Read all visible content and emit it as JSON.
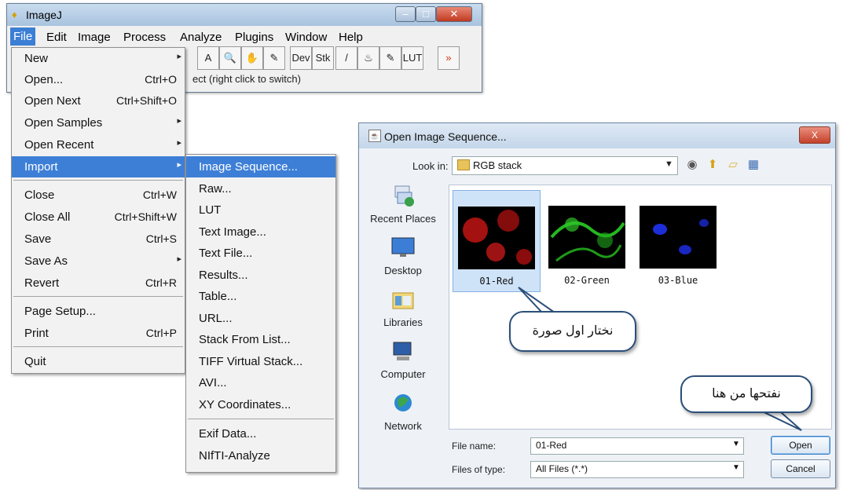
{
  "imagej": {
    "title": "ImageJ",
    "menubar": [
      "File",
      "Edit",
      "Image",
      "Process",
      "Analyze",
      "Plugins",
      "Window",
      "Help"
    ],
    "toolbar": [
      "A",
      "🔍",
      "✋",
      "✎",
      "Dev",
      "Stk",
      "/",
      "♨",
      "✎",
      "LUT",
      "»"
    ],
    "status": "ect (right click to switch)"
  },
  "file_menu": {
    "items": [
      {
        "label": "New",
        "shortcut": "",
        "arrow": "▸"
      },
      {
        "label": "Open...",
        "shortcut": "Ctrl+O"
      },
      {
        "label": "Open Next",
        "shortcut": "Ctrl+Shift+O"
      },
      {
        "label": "Open Samples",
        "shortcut": "",
        "arrow": "▸"
      },
      {
        "label": "Open Recent",
        "shortcut": "",
        "arrow": "▸"
      },
      {
        "label": "Import",
        "shortcut": "",
        "arrow": "▸"
      },
      {
        "label": "Close",
        "shortcut": "Ctrl+W"
      },
      {
        "label": "Close All",
        "shortcut": "Ctrl+Shift+W"
      },
      {
        "label": "Save",
        "shortcut": "Ctrl+S"
      },
      {
        "label": "Save As",
        "shortcut": "",
        "arrow": "▸"
      },
      {
        "label": "Revert",
        "shortcut": "Ctrl+R"
      },
      {
        "label": "Page Setup...",
        "shortcut": ""
      },
      {
        "label": "Print",
        "shortcut": "Ctrl+P"
      },
      {
        "label": "Quit",
        "shortcut": ""
      }
    ]
  },
  "import_menu": {
    "items": [
      "Image Sequence...",
      "Raw...",
      "LUT",
      "Text Image...",
      "Text File...",
      "Results...",
      "Table...",
      "URL...",
      "Stack From List...",
      "TIFF Virtual Stack...",
      "AVI...",
      "XY Coordinates...",
      "Exif Data...",
      "NIfTI-Analyze"
    ]
  },
  "dialog": {
    "title": "Open Image Sequence...",
    "close_label": "X",
    "lookin_label": "Look in:",
    "lookin_value": "RGB stack",
    "places": [
      "Recent Places",
      "Desktop",
      "Libraries",
      "Computer",
      "Network"
    ],
    "files": [
      {
        "label": "01-Red",
        "color": "#d01818"
      },
      {
        "label": "02-Green",
        "color": "#22b41e"
      },
      {
        "label": "03-Blue",
        "color": "#1a2ad8"
      }
    ],
    "callout_choose": "نختار اول صورة",
    "callout_open": "نفتحها من هنا",
    "filename_label": "File name:",
    "filename_value": "01-Red",
    "filetype_label": "Files of type:",
    "filetype_value": "All Files (*.*)",
    "open_label": "Open",
    "cancel_label": "Cancel"
  },
  "colors": {
    "selection": "#3d7fd7",
    "accent_border": "#2b4f7a"
  }
}
